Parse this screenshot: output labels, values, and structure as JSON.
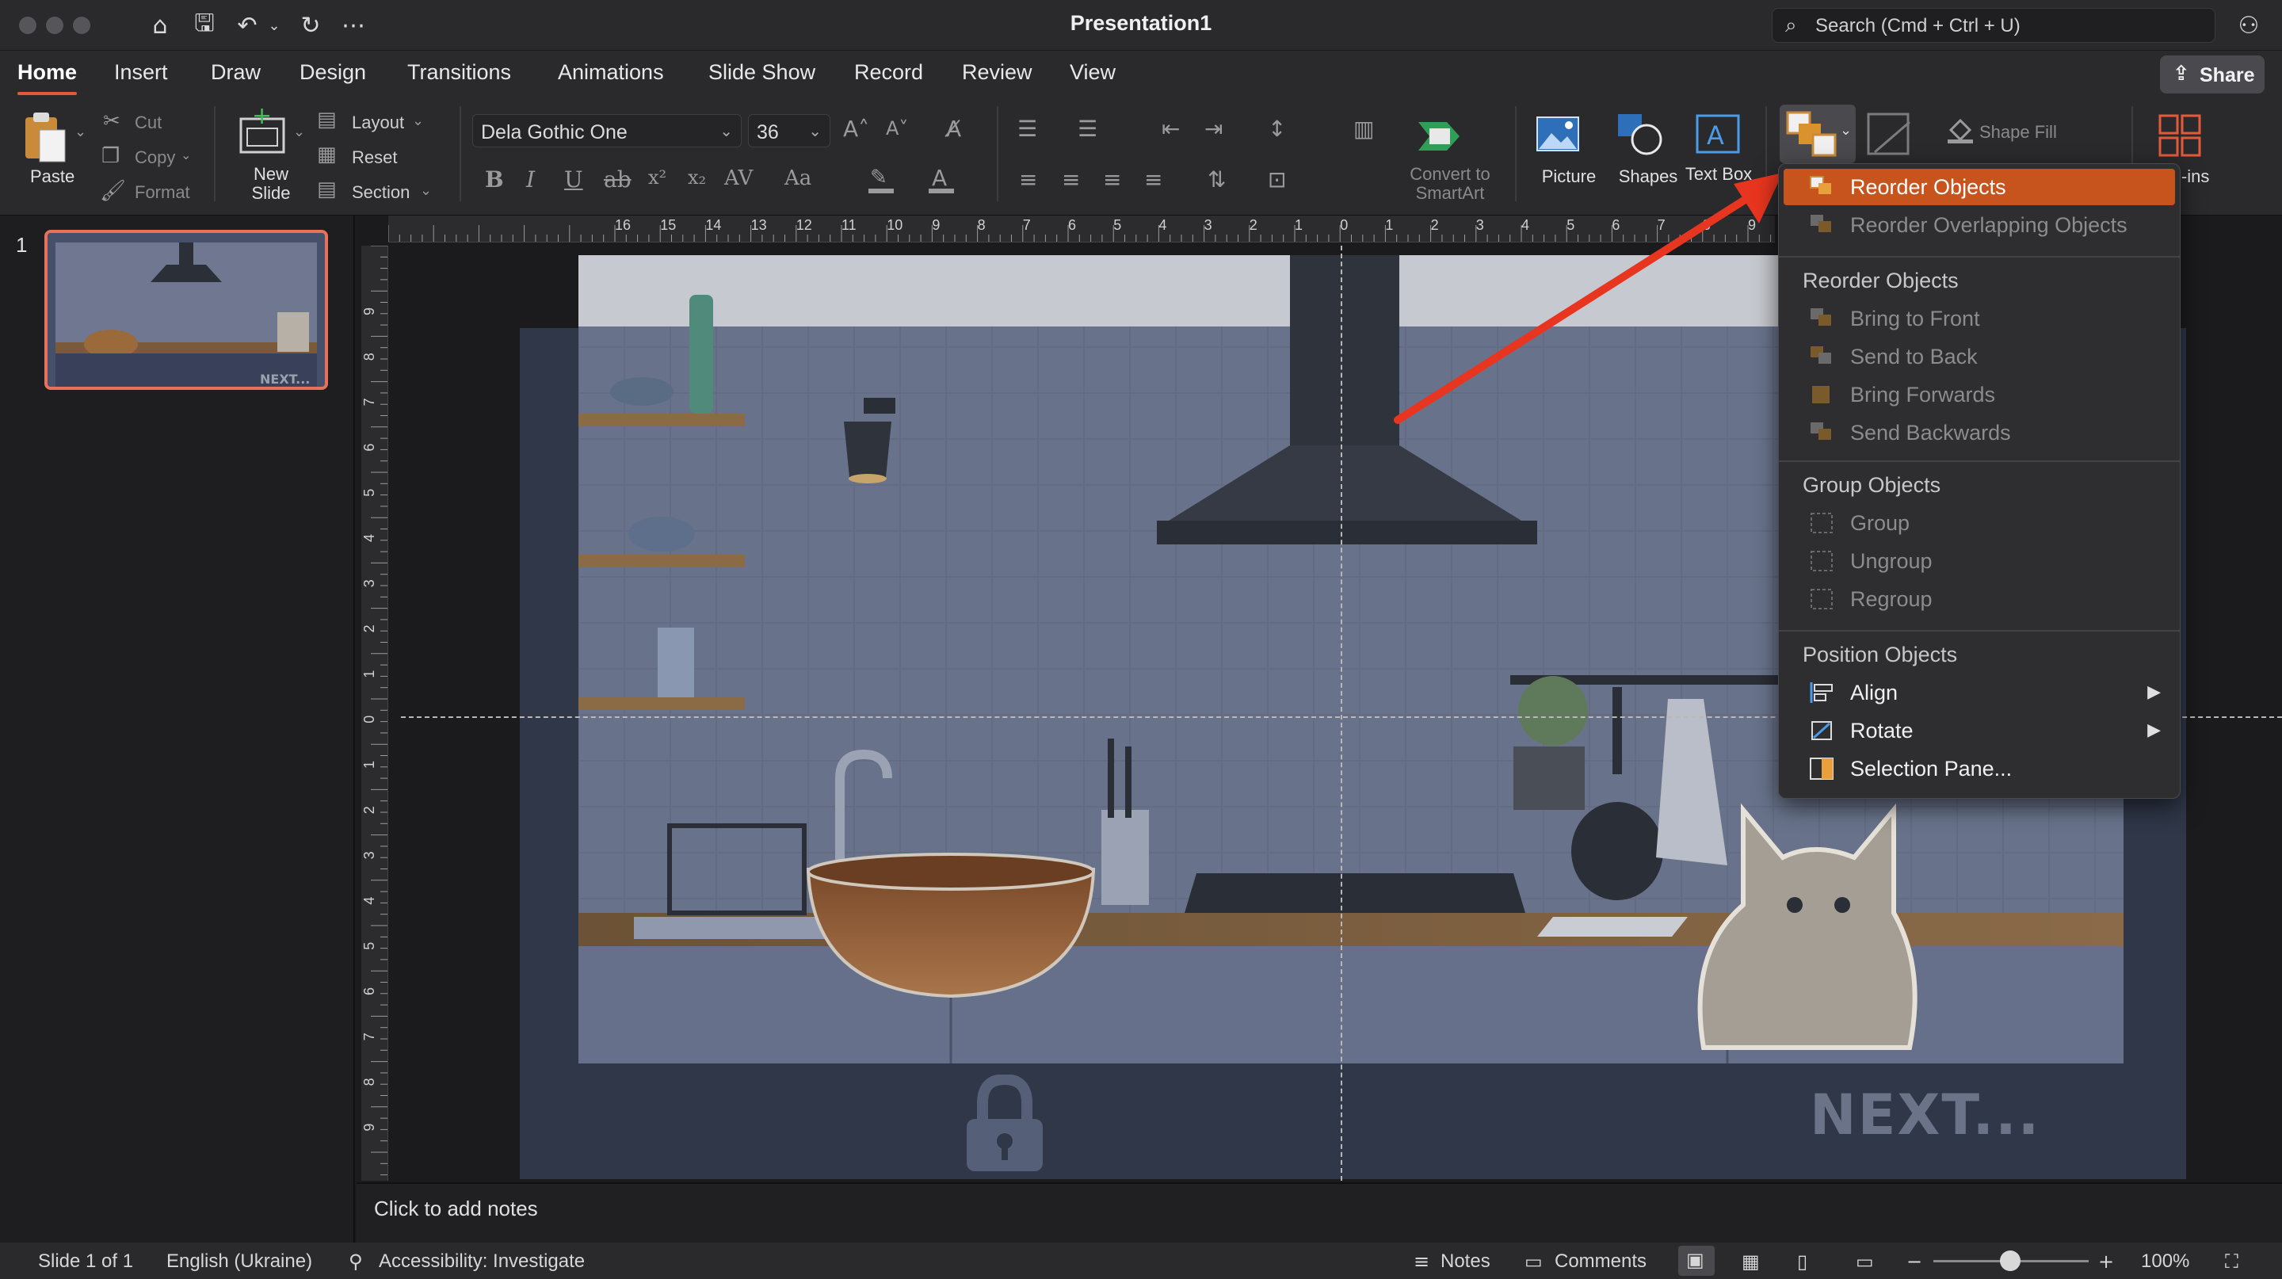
{
  "window": {
    "title": "Presentation1",
    "search_placeholder": "Search (Cmd + Ctrl + U)"
  },
  "tabs": [
    "Home",
    "Insert",
    "Draw",
    "Design",
    "Transitions",
    "Animations",
    "Slide Show",
    "Record",
    "Review",
    "View"
  ],
  "share_label": "Share",
  "ribbon": {
    "paste": "Paste",
    "cut": "Cut",
    "copy": "Copy",
    "format": "Format",
    "new_slide": "New Slide",
    "layout": "Layout",
    "reset": "Reset",
    "section": "Section",
    "font_name": "Dela Gothic One",
    "font_size": "36",
    "convert_smartart": "Convert to SmartArt",
    "picture": "Picture",
    "shapes": "Shapes",
    "text_box": "Text Box",
    "shape_fill": "Shape Fill",
    "addins_partial": "l-ins"
  },
  "slide_panel": {
    "slide_number": "1"
  },
  "ruler": {
    "h_ticks": [
      "16",
      "15",
      "14",
      "13",
      "12",
      "11",
      "10",
      "9",
      "8",
      "7",
      "6",
      "5",
      "4",
      "3",
      "2",
      "1",
      "0",
      "1",
      "2",
      "3",
      "4",
      "5",
      "6",
      "7",
      "8",
      "9"
    ],
    "v_ticks": [
      "9",
      "8",
      "7",
      "6",
      "5",
      "4",
      "3",
      "2",
      "1",
      "0",
      "1",
      "2",
      "3",
      "4",
      "5",
      "6",
      "7",
      "8",
      "9"
    ]
  },
  "slide": {
    "next_text": "NEXT..."
  },
  "notes_placeholder": "Click to add notes",
  "menu": {
    "top_item": "Reorder Objects",
    "top_item2": "Reorder Overlapping Objects",
    "section1": "Reorder Objects",
    "items1": [
      "Bring to Front",
      "Send to Back",
      "Bring Forwards",
      "Send Backwards"
    ],
    "section2": "Group Objects",
    "items2": [
      "Group",
      "Ungroup",
      "Regroup"
    ],
    "section3": "Position Objects",
    "align": "Align",
    "rotate": "Rotate",
    "selection_pane": "Selection Pane..."
  },
  "status": {
    "slide_of": "Slide 1 of 1",
    "language": "English (Ukraine)",
    "accessibility": "Accessibility: Investigate",
    "notes": "Notes",
    "comments": "Comments",
    "zoom": "100%"
  },
  "colors": {
    "accent": "#e25a3a",
    "menu_highlight": "#c8541d",
    "arrow": "#e8351f"
  }
}
